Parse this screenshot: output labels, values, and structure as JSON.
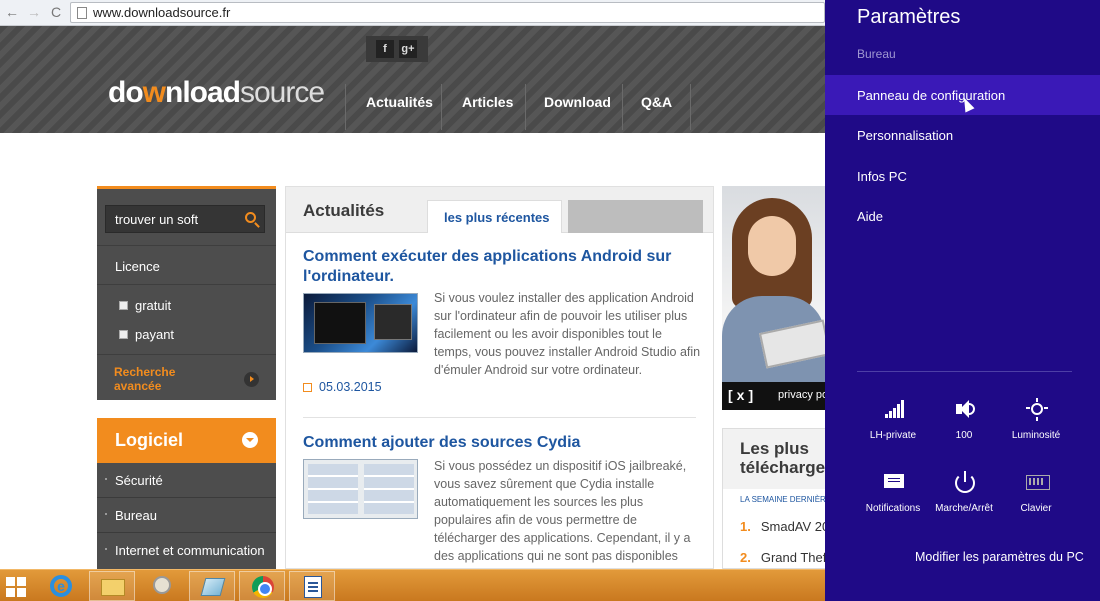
{
  "browser": {
    "url": "www.downloadsource.fr",
    "back": "←",
    "forward": "→",
    "reload": "C"
  },
  "site": {
    "logo_part1": "do",
    "logo_arrow": "w",
    "logo_part2": "nload",
    "logo_part3": "source",
    "social_f": "f",
    "social_g": "g+",
    "nav": [
      "Actualités",
      "Articles",
      "Download",
      "Q&A"
    ]
  },
  "sidebar": {
    "search_placeholder": "trouver un soft",
    "licence_label": "Licence",
    "options": [
      "gratuit",
      "payant"
    ],
    "advanced_line1": "Recherche",
    "advanced_line2": "avancée",
    "category_title": "Logiciel",
    "categories": [
      "Sécurité",
      "Bureau",
      "Internet et communication"
    ]
  },
  "main": {
    "title": "Actualités",
    "tab_active": "les plus récentes",
    "articles": [
      {
        "title_line1": "Comment exécuter des applications Android sur",
        "title_line2": "l'ordinateur.",
        "excerpt": "Si vous voulez installer des application Android sur l'ordinateur afin de pouvoir les utiliser plus facilement ou les avoir disponibles tout le temps, vous pouvez installer Android Studio afin d'émuler Android sur votre ordinateur.",
        "date": "05.03.2015"
      },
      {
        "title_line1": "Comment ajouter des sources Cydia",
        "excerpt": "Si vous possédez un dispositif iOS jailbreaké, vous savez sûrement que Cydia installe automatiquement les sources les plus populaires afin de vous permettre de télécharger des applications. Cependant, il y a des applications qui ne sont pas disponibles"
      }
    ]
  },
  "banner": {
    "mark": "[x]",
    "text": "privacy po"
  },
  "top_downloads": {
    "title_line1": "Les plus",
    "title_line2": "télécharge",
    "subtitle": "LA SEMAINE DERNIÈRE",
    "items": [
      {
        "rank": "1.",
        "name": "SmadAV 20"
      },
      {
        "rank": "2.",
        "name": "Grand Thef"
      }
    ]
  },
  "charm": {
    "title": "Paramètres",
    "context": "Bureau",
    "items": [
      "Panneau de configuration",
      "Personnalisation",
      "Infos PC",
      "Aide"
    ],
    "selected_item": "Panneau de configuration",
    "tiles": [
      "LH-private",
      "100",
      "Luminosité",
      "Notifications",
      "Marche/Arrêt",
      "Clavier"
    ],
    "footer": "Modifier les paramètres du PC"
  },
  "taskbar": {
    "apps": [
      "windows-start",
      "internet-explorer",
      "file-explorer",
      "paint",
      "snipping-tool",
      "google-chrome",
      "wordpad"
    ]
  },
  "colors": {
    "accent_orange": "#f28c1e",
    "link_blue": "#1e56a0",
    "charm_bg": "#1f0a87",
    "charm_selected": "#3a19b7"
  }
}
